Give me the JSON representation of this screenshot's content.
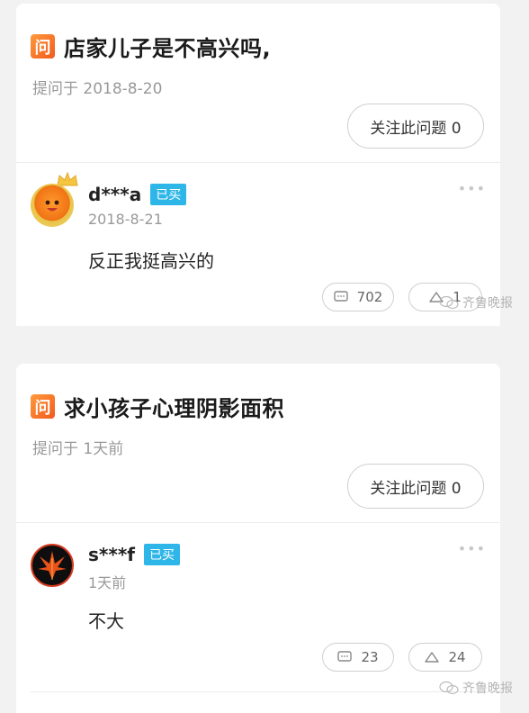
{
  "cards": [
    {
      "badge": "问",
      "question": "店家儿子是不高兴吗,",
      "asked_meta": "提问于 2018-8-20",
      "follow_label": "关注此问题 0",
      "answer": {
        "username": "d***a",
        "bought_label": "已买",
        "date": "2018-8-21",
        "text": "反正我挺高兴的",
        "comment_count": "702",
        "like_count": "1"
      }
    },
    {
      "badge": "问",
      "question": "求小孩子心理阴影面积",
      "asked_meta": "提问于 1天前",
      "follow_label": "关注此问题 0",
      "answer": {
        "username": "s***f",
        "bought_label": "已买",
        "date": "1天前",
        "text": "不大",
        "comment_count": "23",
        "like_count": "24"
      }
    }
  ],
  "watermark": "齐鲁晚报",
  "more_glyph": "•••",
  "colors": {
    "badge_orange": "#f25a1d",
    "bought_blue": "#2fb6e8",
    "muted_text": "#999999"
  },
  "icons": [
    "question-badge-icon",
    "crown-icon",
    "comment-icon",
    "like-icon",
    "more-icon",
    "wechat-icon"
  ]
}
